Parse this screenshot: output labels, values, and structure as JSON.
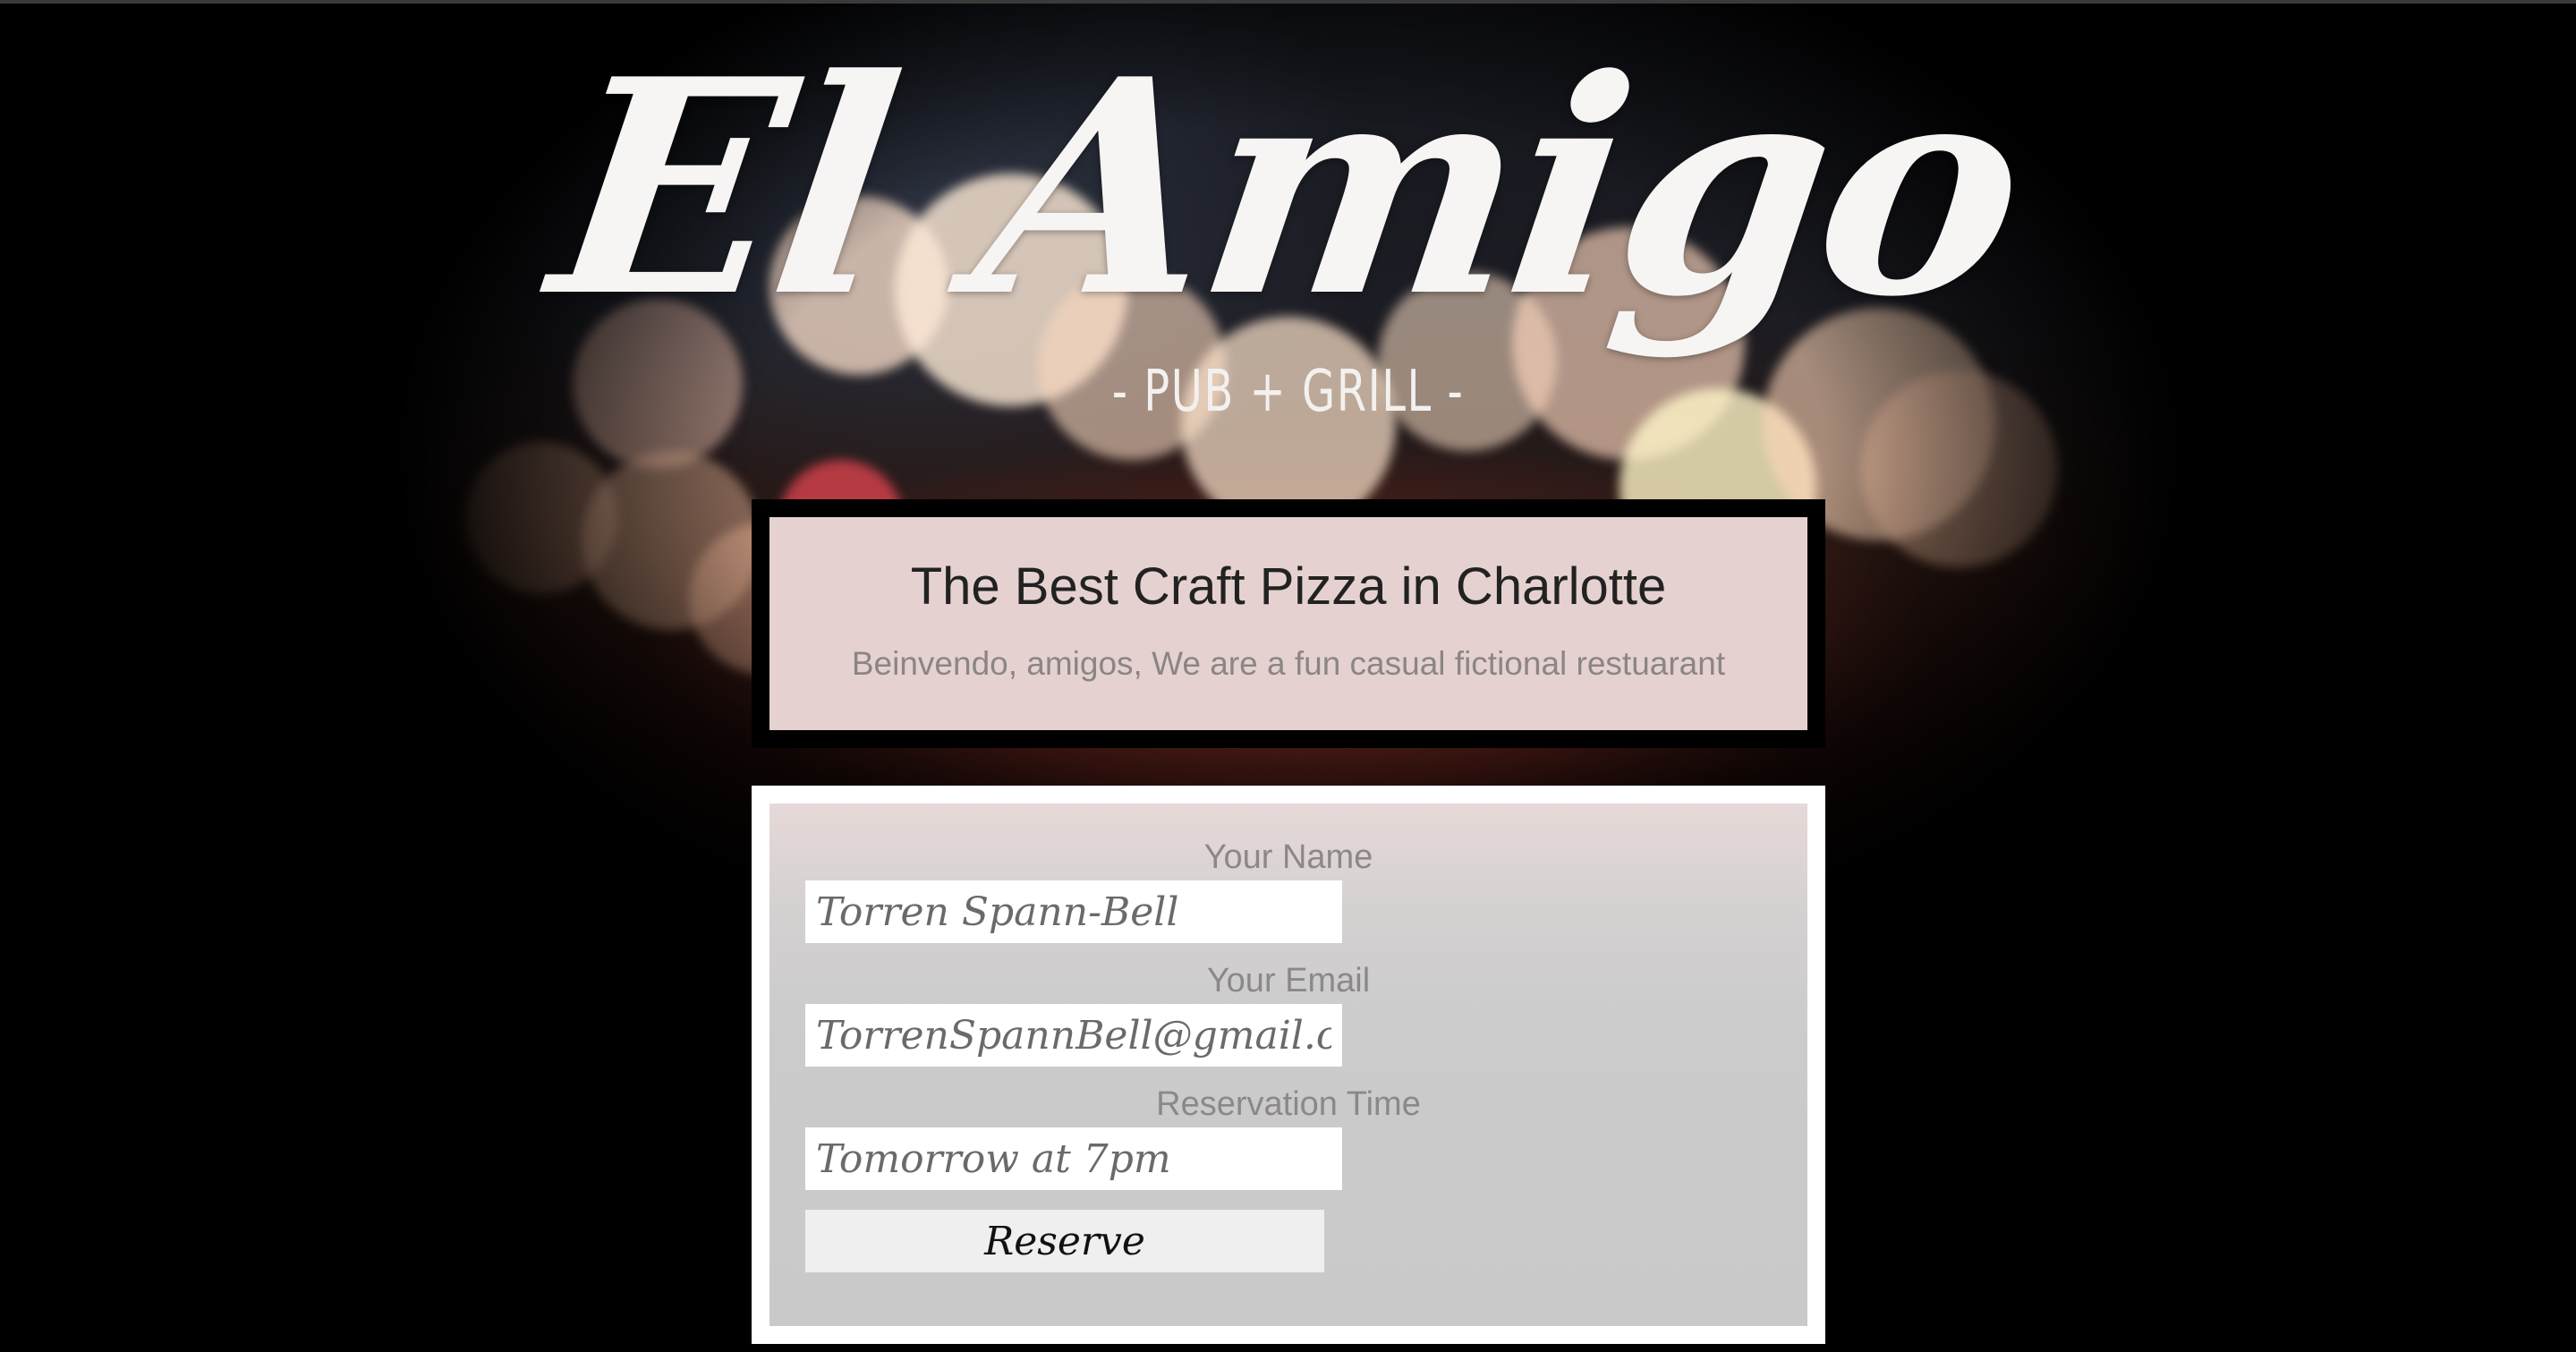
{
  "header": {
    "logo_title": "El Amigo",
    "logo_subtitle": "- PUB + GRILL -"
  },
  "intro": {
    "heading": "The Best Craft Pizza in Charlotte",
    "text": "Beinvendo, amigos, We are a fun casual fictional restuarant"
  },
  "reservation_form": {
    "name_label": "Your Name",
    "name_value": "Torren Spann-Bell",
    "email_label": "Your Email",
    "email_value": "TorrenSpannBell@gmail.com",
    "time_label": "Reservation Time",
    "time_value": "Tomorrow at 7pm",
    "submit_label": "Reserve"
  }
}
